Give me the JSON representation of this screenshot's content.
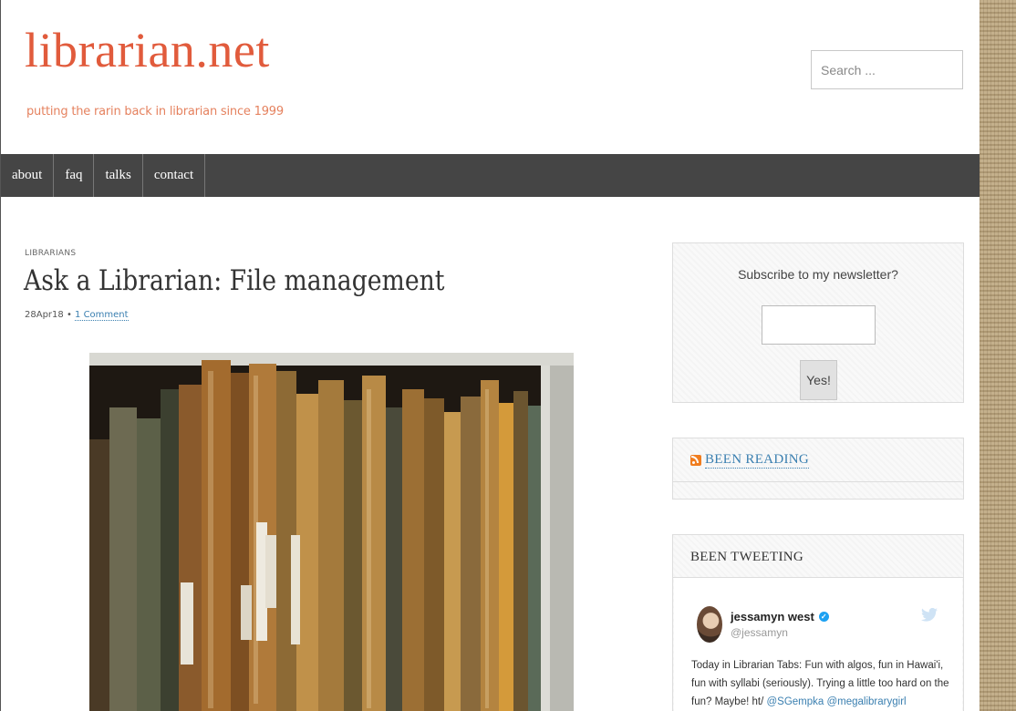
{
  "site": {
    "title": "librarian.net",
    "tagline": "putting the rarin back in librarian since 1999"
  },
  "search": {
    "placeholder": "Search ..."
  },
  "nav": {
    "items": [
      "about",
      "faq",
      "talks",
      "contact"
    ]
  },
  "post": {
    "category": "LIBRARIANS",
    "title": "Ask a Librarian: File management",
    "date": "28Apr18",
    "separator": "•",
    "comments": "1 Comment"
  },
  "newsletter": {
    "label": "Subscribe to my newsletter?",
    "button": "Yes!"
  },
  "reading": {
    "title": "BEEN READING"
  },
  "tweeting": {
    "title": "BEEN TWEETING",
    "name": "jessamyn west",
    "handle": "@jessamyn",
    "text": "Today in Librarian Tabs: Fun with algos, fun in Hawai'i, fun with syllabi (seriously). Trying a little too hard on the fun? Maybe! ht/",
    "mentions": "@SGempka @megalibrarygirl"
  },
  "colors": {
    "title": "#e15b3c",
    "nav_bg": "#454545",
    "link": "#3a7fb0"
  },
  "icons": [
    "rss-icon",
    "verified-icon",
    "twitter-icon"
  ]
}
